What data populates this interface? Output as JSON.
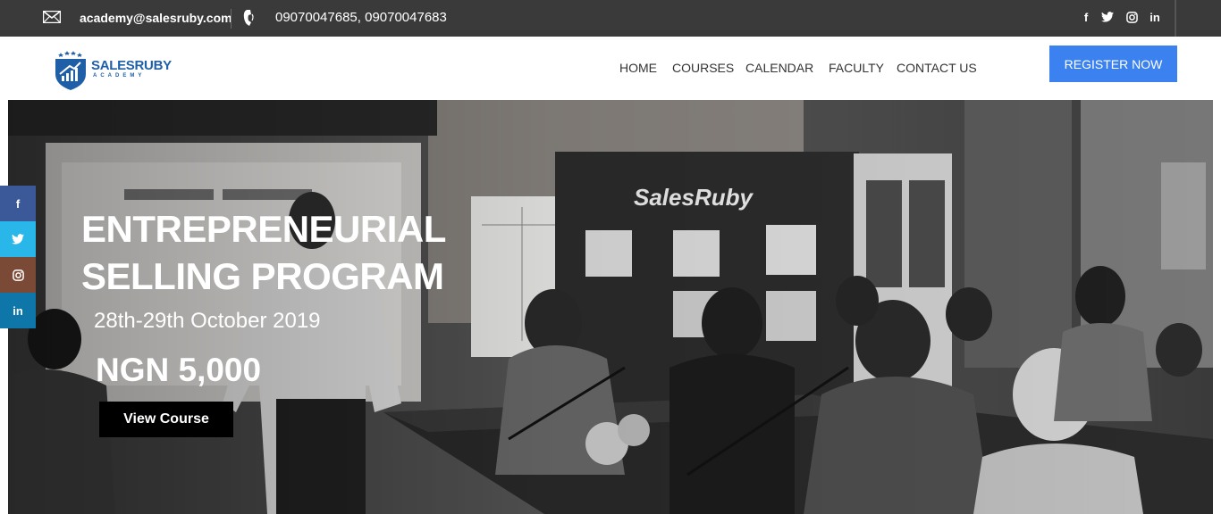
{
  "topbar": {
    "email": "academy@salesruby.com",
    "phone": "09070047685, 09070047683",
    "social": [
      {
        "icon": "facebook-icon",
        "glyph": "f"
      },
      {
        "icon": "twitter-icon",
        "glyph": "t"
      },
      {
        "icon": "instagram-icon",
        "glyph": "◎"
      },
      {
        "icon": "linkedin-icon",
        "glyph": "in"
      }
    ]
  },
  "header": {
    "logo_text": "SALESRUBY",
    "logo_sub": "ACADEMY",
    "nav": [
      "HOME",
      "COURSES",
      "CALENDAR",
      "FACULTY",
      "CONTACT US"
    ],
    "register_label": "REGISTER NOW"
  },
  "hero": {
    "title_line1": "ENTREPRENEURIAL",
    "title_line2": "SELLING PROGRAM",
    "date": "28th-29th October 2019",
    "price": "NGN 5,000",
    "button_label": "View Course"
  },
  "side_social": [
    {
      "icon": "facebook-icon",
      "glyph": "f",
      "color": "#3b5998"
    },
    {
      "icon": "twitter-icon",
      "glyph": "t",
      "color": "#29b6e8"
    },
    {
      "icon": "instagram-icon",
      "glyph": "◎",
      "color": "#7a4a36"
    },
    {
      "icon": "linkedin-icon",
      "glyph": "in",
      "color": "#0e76a8"
    }
  ],
  "colors": {
    "topbar": "#3a3a3a",
    "accent": "#3b82f0",
    "brand": "#1f5fa8"
  }
}
